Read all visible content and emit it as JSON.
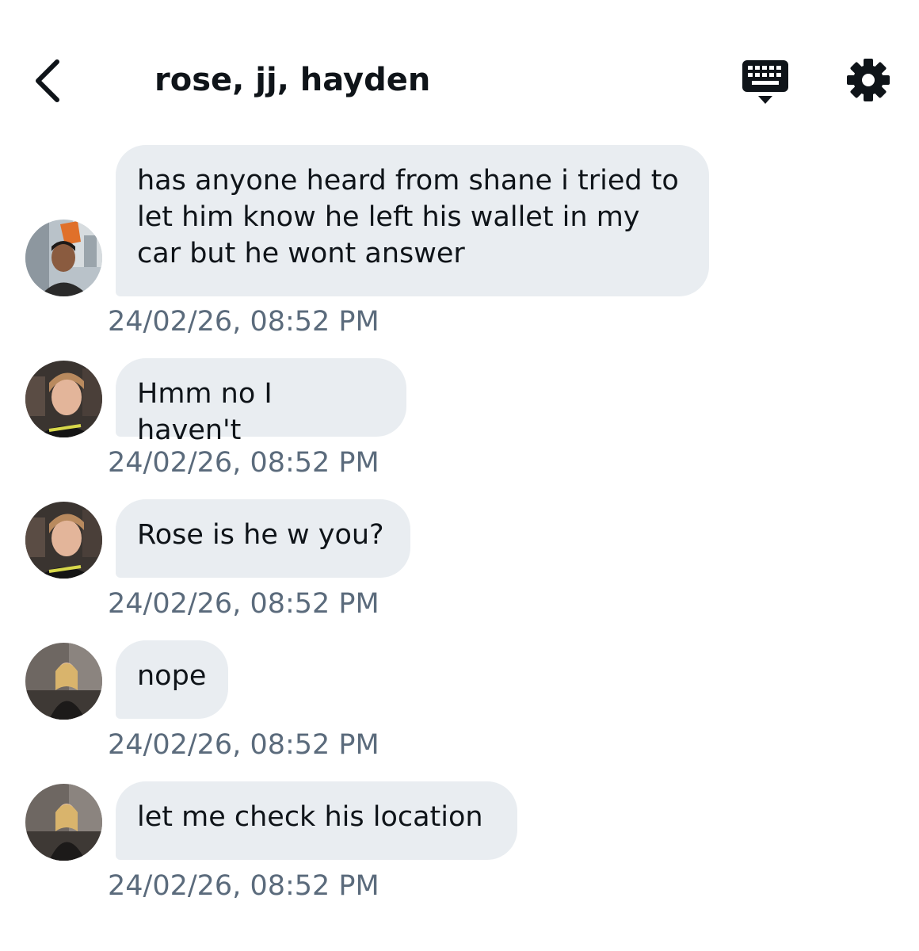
{
  "header": {
    "title": "rose, jj, hayden",
    "back_icon": "chevron-left-icon",
    "keyboard_icon": "keyboard-icon",
    "settings_icon": "gear-icon"
  },
  "colors": {
    "bubble_bg": "#e9edf1",
    "text": "#0f1419",
    "timestamp": "#5b6b7c"
  },
  "messages": [
    {
      "sender_avatar": "avatar-jj",
      "text": "has anyone heard from shane i tried to let him know he left his wallet in my car but he wont answer",
      "timestamp": "24/02/26, 08:52 PM"
    },
    {
      "sender_avatar": "avatar-hayden",
      "text": "Hmm no I haven't",
      "timestamp": "24/02/26, 08:52 PM"
    },
    {
      "sender_avatar": "avatar-hayden",
      "text": "Rose is he w you?",
      "timestamp": "24/02/26, 08:52 PM"
    },
    {
      "sender_avatar": "avatar-rose",
      "text": "nope",
      "timestamp": "24/02/26, 08:52 PM"
    },
    {
      "sender_avatar": "avatar-rose",
      "text": "let me check his location",
      "timestamp": "24/02/26, 08:52 PM"
    }
  ]
}
